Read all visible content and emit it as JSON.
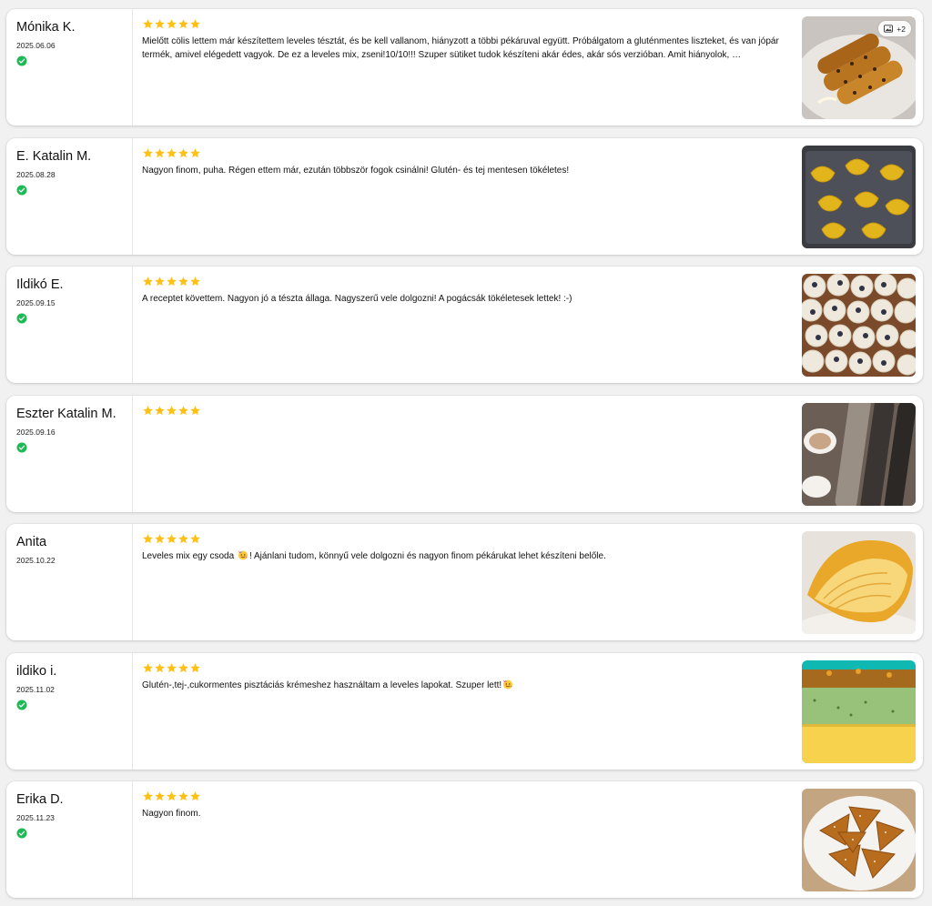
{
  "colors": {
    "star": "#FFC117",
    "verified": "#1DB954",
    "card_bg": "#FFFFFF",
    "page_bg": "#F1F1F1"
  },
  "reviews": [
    {
      "author": "Mónika K.",
      "date": "2025.06.06",
      "verified": true,
      "rating": 5,
      "text": "Mielőtt cölis lettem már készítettem leveles tésztát, és be kell vallanom, hiányzott a többi pékáruval együtt. Próbálgatom a gluténmentes liszteket, és van jópár termék, amivel elégedett vagyok. De ez a leveles mix, zseni!10/10!!! Szuper sütiket tudok készíteni akár édes, akár sós verzióban. Amit hiányolok, …",
      "text_after": "",
      "emoji": "",
      "photo": "pastry-sticks",
      "extra_photos": "+2"
    },
    {
      "author": "E. Katalin M.",
      "date": "2025.08.28",
      "verified": true,
      "rating": 5,
      "text": "Nagyon finom, puha. Régen ettem már, ezután többször fogok csinálni! Glutén- és tej mentesen tökéletes!",
      "text_after": "",
      "emoji": "",
      "photo": "croissants-tray",
      "extra_photos": ""
    },
    {
      "author": "Ildikó E.",
      "date": "2025.09.15",
      "verified": true,
      "rating": 5,
      "text": "A receptet követtem. Nagyon jó a tészta állaga. Nagyszerű vele dolgozni! A pogácsák tökéletesek lettek! :-)",
      "text_after": "",
      "emoji": "",
      "photo": "pogacsa",
      "extra_photos": ""
    },
    {
      "author": "Eszter Katalin M.",
      "date": "2025.09.16",
      "verified": true,
      "rating": 5,
      "text": "",
      "text_after": "",
      "emoji": "",
      "photo": "baguettes",
      "extra_photos": ""
    },
    {
      "author": "Anita",
      "date": "2025.10.22",
      "verified": false,
      "rating": 5,
      "text": "Leveles mix egy csoda ",
      "text_after": "! Ajánlani tudom, könnyű vele dolgozni és nagyon finom pékárukat lehet készíteni belőle.",
      "emoji": "party-face",
      "photo": "croissant-closeup",
      "extra_photos": ""
    },
    {
      "author": "ildiko i.",
      "date": "2025.11.02",
      "verified": true,
      "rating": 5,
      "text": "Glutén-,tej-,cukormentes pisztáciás krémeshez használtam a leveles lapokat. Szuper lett!",
      "text_after": "",
      "emoji": "party-face",
      "photo": "pistachio-cake",
      "extra_photos": ""
    },
    {
      "author": "Erika D.",
      "date": "2025.11.23",
      "verified": true,
      "rating": 5,
      "text": "Nagyon finom.",
      "text_after": "",
      "emoji": "",
      "photo": "triangle-pastries",
      "extra_photos": ""
    }
  ]
}
